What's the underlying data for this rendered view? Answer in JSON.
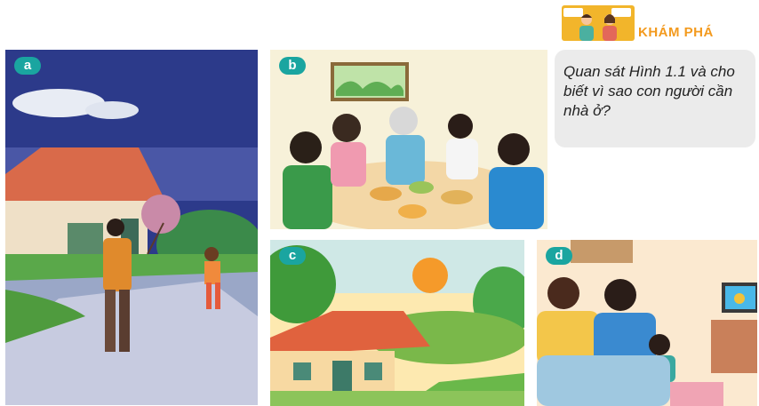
{
  "header": {
    "title": "KHÁM PHÁ",
    "icon": "two-people-discussion-icon"
  },
  "question": {
    "text": "Quan sát Hình 1.1 và cho biết vì sao con người cần nhà ở?"
  },
  "panels": [
    {
      "label": "a"
    },
    {
      "label": "b"
    },
    {
      "label": "c"
    },
    {
      "label": "d"
    }
  ],
  "colors": {
    "badge": "#1aa5a0",
    "accent": "#f39a1e",
    "question_bg": "#ebebeb"
  }
}
